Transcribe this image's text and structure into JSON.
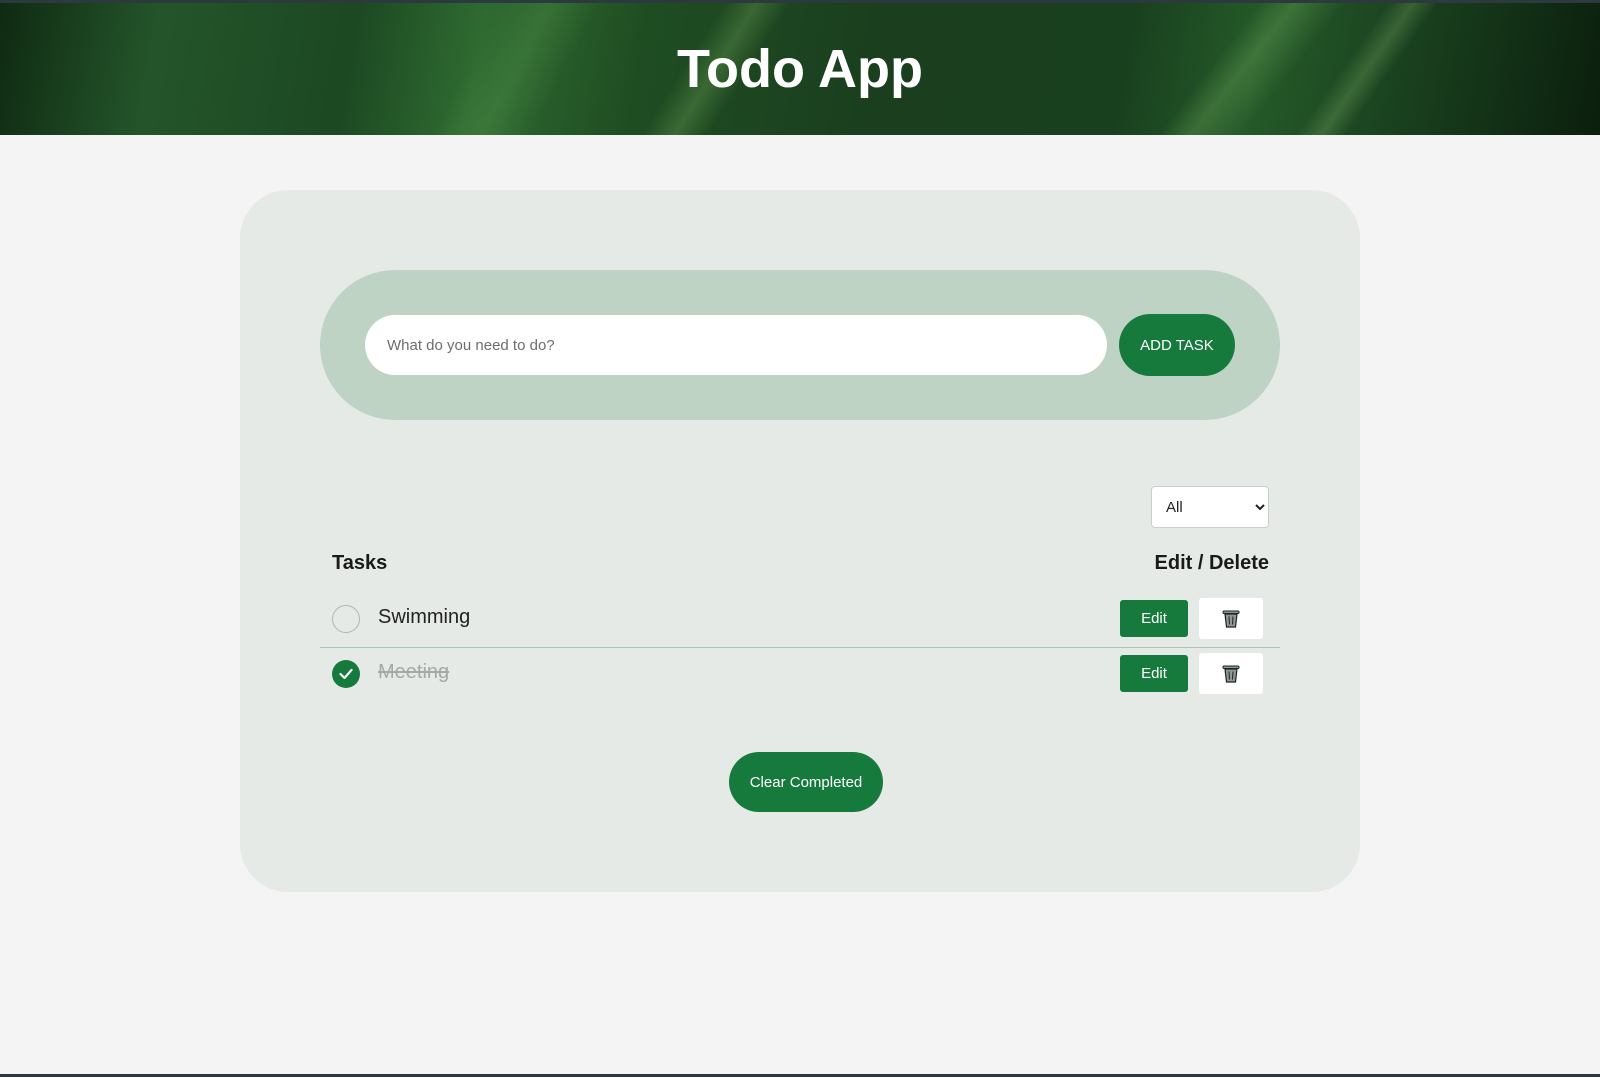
{
  "header": {
    "title": "Todo App"
  },
  "add_task": {
    "input_placeholder": "What do you need to do?",
    "input_value": "",
    "button_label": "ADD TASK"
  },
  "filter": {
    "selected": "All"
  },
  "columns": {
    "tasks_label": "Tasks",
    "actions_label": "Edit / Delete"
  },
  "tasks": [
    {
      "text": "Swimming",
      "completed": false,
      "edit_label": "Edit",
      "delete_icon": "trash-icon"
    },
    {
      "text": "Meeting",
      "completed": true,
      "edit_label": "Edit",
      "delete_icon": "trash-icon"
    }
  ],
  "footer": {
    "clear_label": "Clear Completed"
  },
  "colors": {
    "accent": "#177a3d",
    "card_bg": "#e5eae7",
    "pill_bg": "#bfd3c5",
    "page_bg": "#f4f4f4"
  }
}
